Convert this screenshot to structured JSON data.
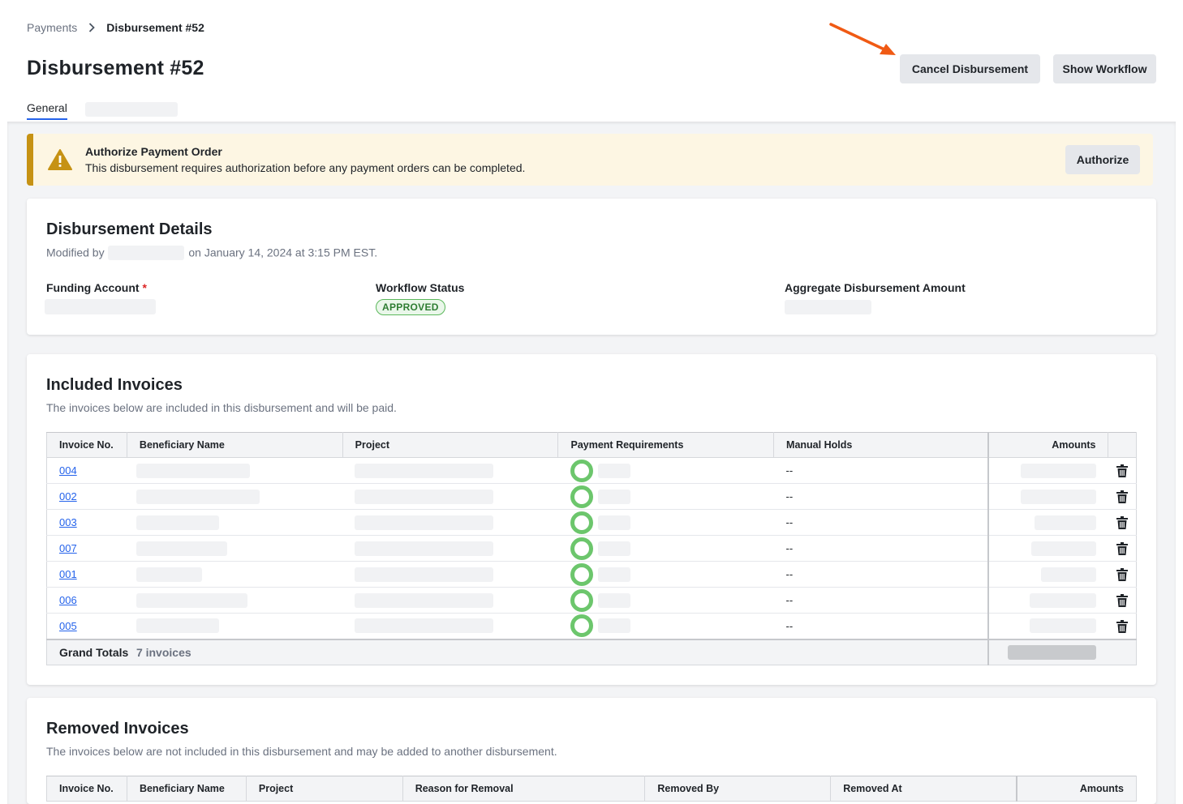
{
  "breadcrumb": {
    "parent": "Payments",
    "current": "Disbursement #52"
  },
  "page_title": "Disbursement #52",
  "actions": {
    "cancel_label": "Cancel Disbursement",
    "workflow_label": "Show Workflow"
  },
  "tabs": [
    {
      "label": "General"
    }
  ],
  "alert": {
    "title": "Authorize Payment Order",
    "text": "This disbursement requires authorization before any payment orders can be completed.",
    "button_label": "Authorize"
  },
  "details": {
    "title": "Disbursement Details",
    "modified_prefix": "Modified by",
    "modified_suffix": "on January 14, 2024 at 3:15 PM EST.",
    "funding_label": "Funding Account",
    "required_mark": "*",
    "workflow_label": "Workflow Status",
    "workflow_status": "APPROVED",
    "aggregate_label": "Aggregate Disbursement Amount"
  },
  "included": {
    "title": "Included Invoices",
    "subtitle": "The invoices below are included in this disbursement and will be paid.",
    "columns": {
      "invoice_no": "Invoice No.",
      "beneficiary": "Beneficiary Name",
      "project": "Project",
      "payment_requirements": "Payment Requirements",
      "manual_holds": "Manual Holds",
      "amounts": "Amounts"
    },
    "rows": [
      {
        "invoice": "004",
        "holds": "--"
      },
      {
        "invoice": "002",
        "holds": "--"
      },
      {
        "invoice": "003",
        "holds": "--"
      },
      {
        "invoice": "007",
        "holds": "--"
      },
      {
        "invoice": "001",
        "holds": "--"
      },
      {
        "invoice": "006",
        "holds": "--"
      },
      {
        "invoice": "005",
        "holds": "--"
      }
    ],
    "totals": {
      "label": "Grand Totals",
      "count": "7 invoices"
    }
  },
  "removed": {
    "title": "Removed Invoices",
    "subtitle": "The invoices below are not included in this disbursement and may be added to another disbursement.",
    "columns": {
      "invoice_no": "Invoice No.",
      "beneficiary": "Beneficiary Name",
      "project": "Project",
      "reason": "Reason for Removal",
      "removed_by": "Removed By",
      "removed_at": "Removed At",
      "amounts": "Amounts"
    }
  },
  "colors": {
    "accent": "#2563eb",
    "warning": "#c69214",
    "success": "#6cc66c",
    "annotation_arrow": "#f05a14"
  }
}
